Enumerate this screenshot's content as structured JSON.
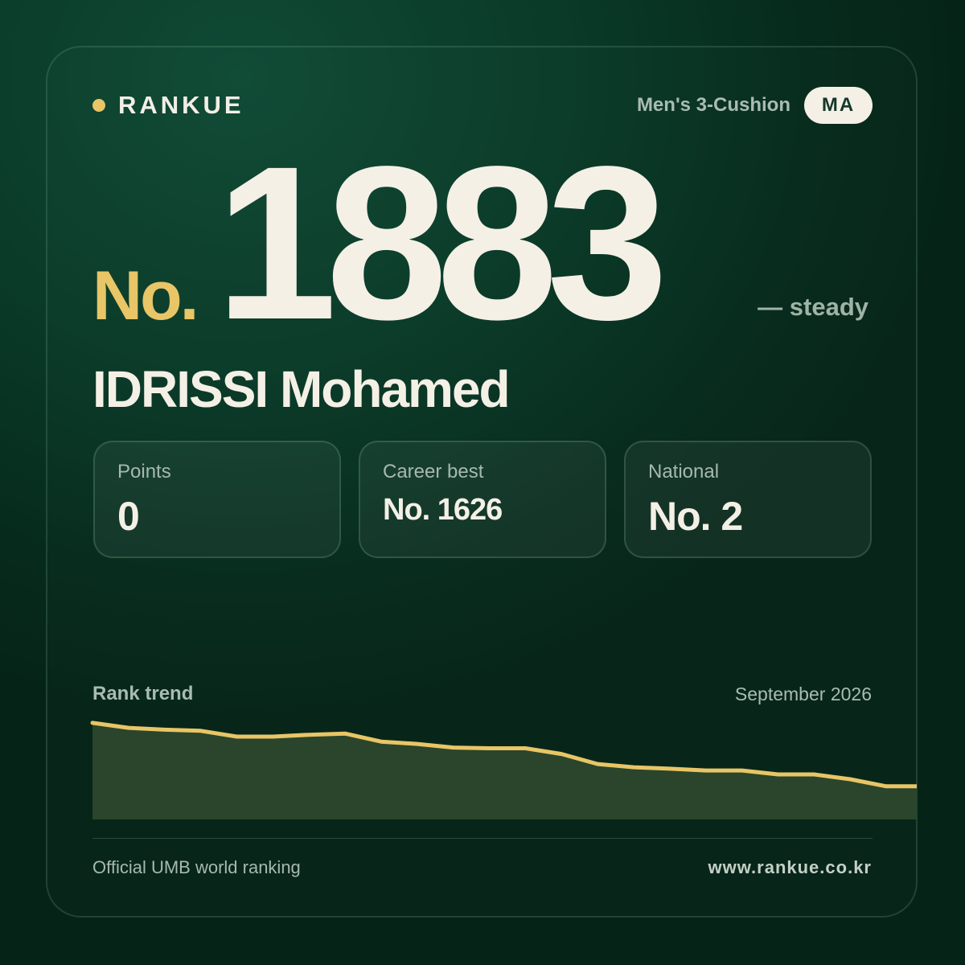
{
  "brand": {
    "name": "RANKUE"
  },
  "header": {
    "category": "Men's 3-Cushion",
    "country_code": "MA"
  },
  "rank": {
    "prefix": "No.",
    "number": "1883",
    "trend": "— steady"
  },
  "player": {
    "name": "IDRISSI Mohamed"
  },
  "stats": [
    {
      "label": "Points",
      "value": "0"
    },
    {
      "label": "Career best",
      "value": "No. 1626"
    },
    {
      "label": "National",
      "value": "No. 2"
    }
  ],
  "trend_section": {
    "title": "Rank trend",
    "date": "September 2026"
  },
  "footer": {
    "left": "Official UMB world ranking",
    "right": "www.rankue.co.kr"
  },
  "colors": {
    "accent": "#e8c566",
    "text": "#f4f0e6",
    "muted": "#a9bcb0",
    "background": "#0a3a28"
  },
  "chart_data": {
    "type": "area",
    "title": "Rank trend",
    "xlabel": "",
    "ylabel": "",
    "x_end_label": "September 2026",
    "y_axis": "rank number, lower is better; axis unlabeled",
    "ylim": [
      1490,
      1900
    ],
    "values": [
      1500,
      1522,
      1530,
      1535,
      1560,
      1560,
      1552,
      1547,
      1582,
      1592,
      1608,
      1611,
      1611,
      1636,
      1680,
      1694,
      1700,
      1708,
      1708,
      1725,
      1725,
      1746,
      1777,
      1777
    ],
    "current": 1883,
    "grid": false,
    "legend": "none"
  }
}
